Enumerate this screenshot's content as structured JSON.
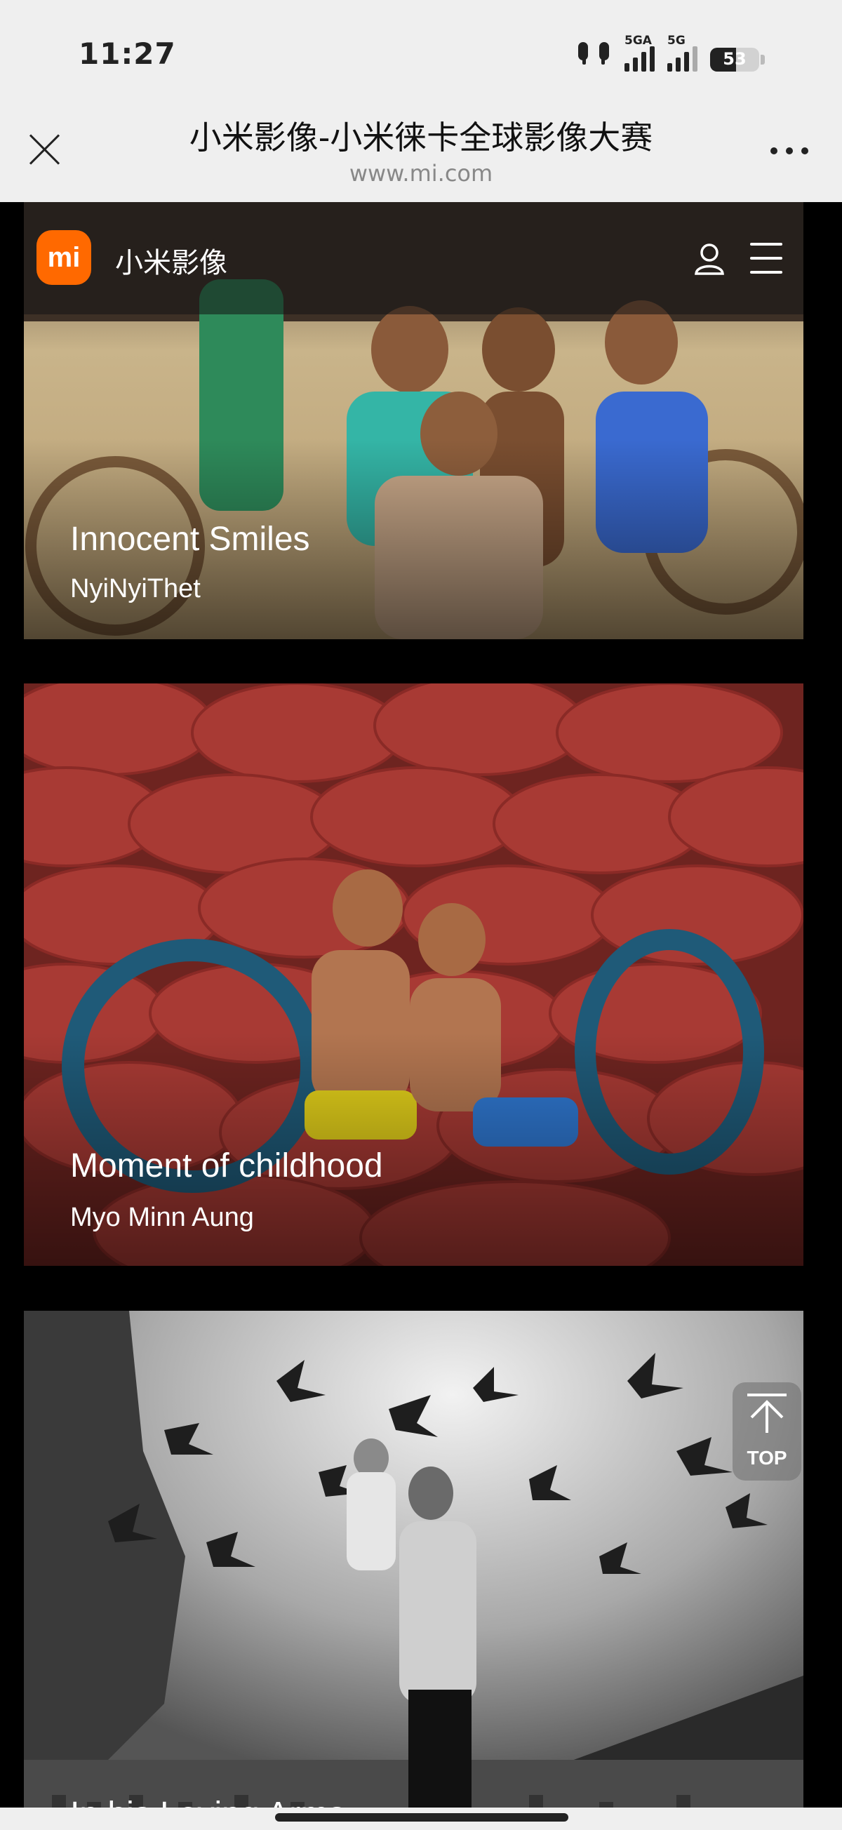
{
  "status_bar": {
    "time": "11:27",
    "network1": "5GA",
    "network2": "5G",
    "battery": "53",
    "battery_level": 0.53
  },
  "title_bar": {
    "title": "小米影像-小米徕卡全球影像大赛",
    "url": "www.mi.com"
  },
  "site_header": {
    "logo_text": "mi",
    "brand": "小米影像"
  },
  "cards": [
    {
      "title": "Innocent Smiles",
      "author": "NyiNyiThet"
    },
    {
      "title": "Moment of childhood",
      "author": "Myo Minn Aung"
    },
    {
      "title": "In his Loving Arms",
      "author": ""
    }
  ],
  "top_button": {
    "label": "TOP"
  },
  "colors": {
    "brand_orange": "#ff6900",
    "chrome_bg": "#efefef"
  }
}
